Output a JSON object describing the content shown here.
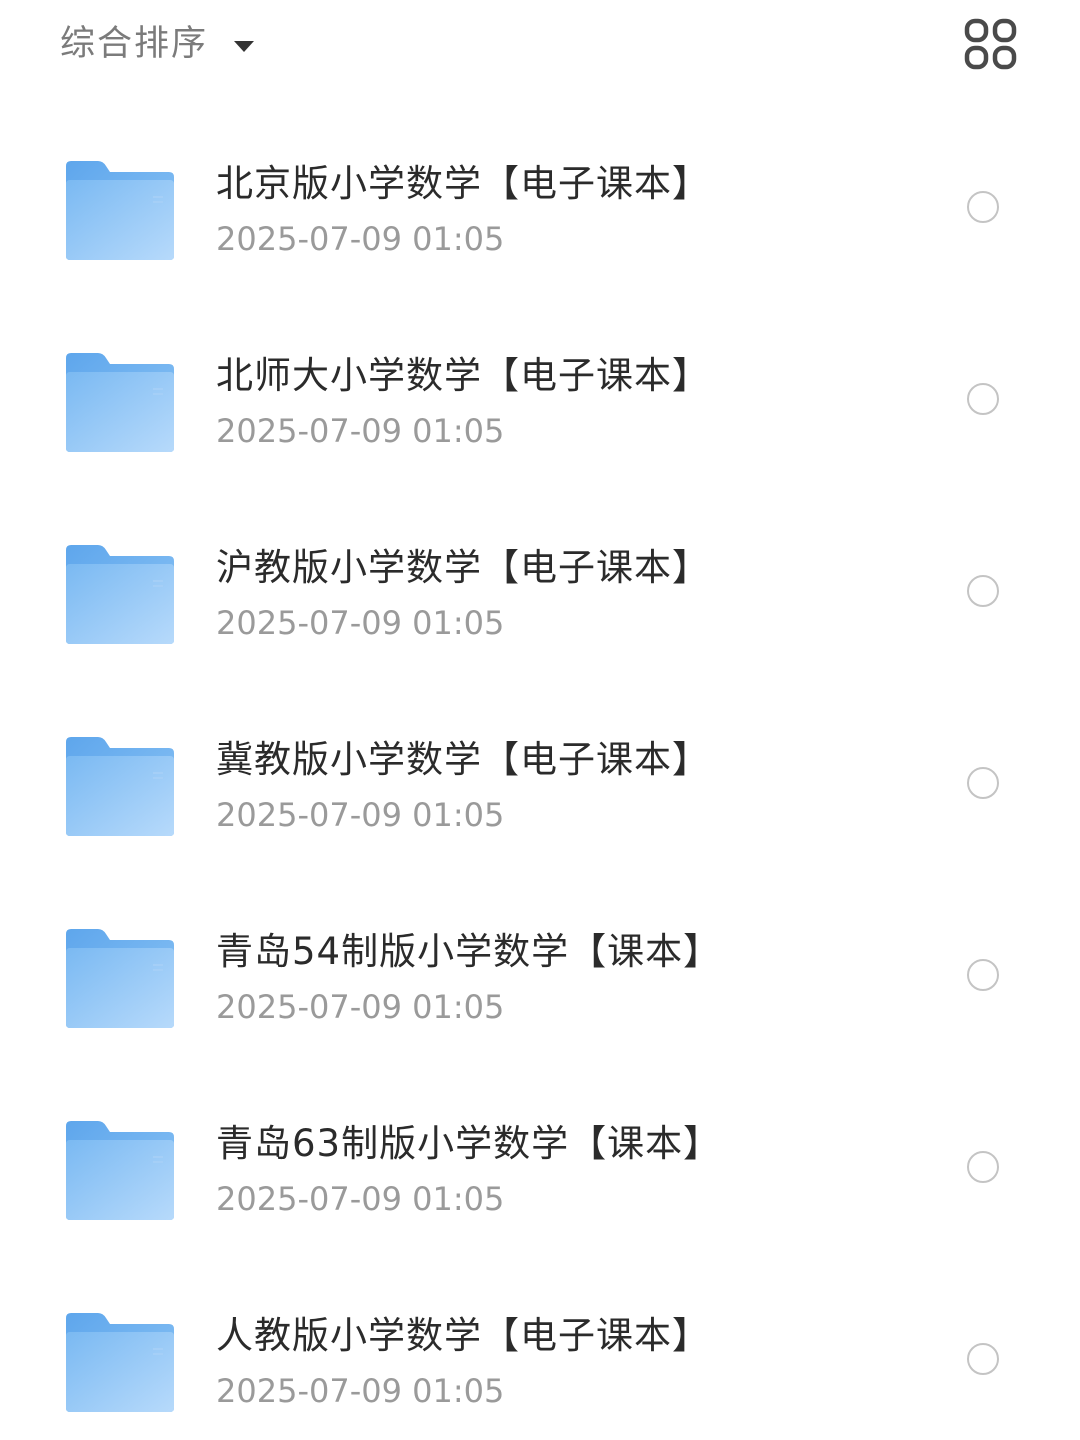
{
  "toolbar": {
    "sort_label": "综合排序",
    "sort_icon": "caret-down-icon",
    "view_toggle_icon": "grid-view-icon"
  },
  "colors": {
    "folder_light": "#bcdcfa",
    "folder_dark": "#6fb2ef",
    "title_text": "#2b2b2b",
    "date_text": "#9a9a9a",
    "radio_border": "#c4c4c4"
  },
  "files": [
    {
      "name": "北京版小学数学【电子课本】",
      "date": "2025-07-09 01:05",
      "icon": "folder-icon",
      "selected": false
    },
    {
      "name": "北师大小学数学【电子课本】",
      "date": "2025-07-09 01:05",
      "icon": "folder-icon",
      "selected": false
    },
    {
      "name": "沪教版小学数学【电子课本】",
      "date": "2025-07-09 01:05",
      "icon": "folder-icon",
      "selected": false
    },
    {
      "name": "冀教版小学数学【电子课本】",
      "date": "2025-07-09 01:05",
      "icon": "folder-icon",
      "selected": false
    },
    {
      "name": "青岛54制版小学数学【课本】",
      "date": "2025-07-09 01:05",
      "icon": "folder-icon",
      "selected": false
    },
    {
      "name": "青岛63制版小学数学【课本】",
      "date": "2025-07-09 01:05",
      "icon": "folder-icon",
      "selected": false
    },
    {
      "name": "人教版小学数学【电子课本】",
      "date": "2025-07-09 01:05",
      "icon": "folder-icon",
      "selected": false
    }
  ]
}
